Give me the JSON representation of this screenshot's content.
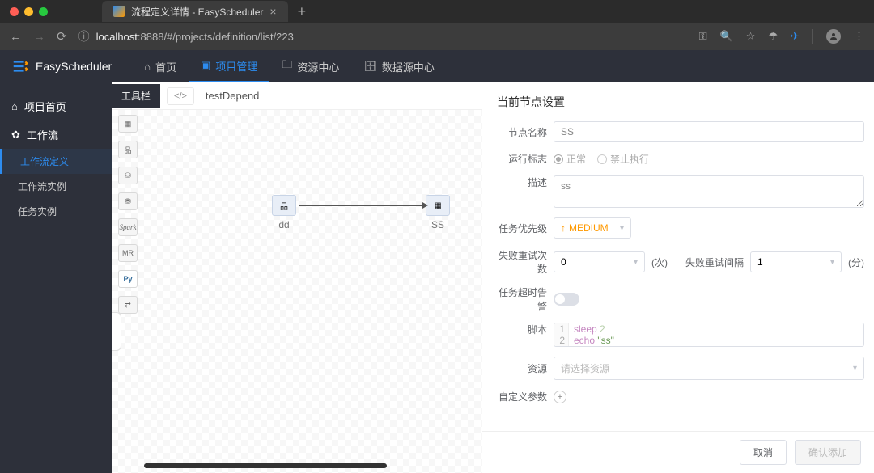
{
  "browser": {
    "tab_title": "流程定义详情 - EasyScheduler",
    "url_prefix": "localhost",
    "url_port": ":8888",
    "url_path": "/#/projects/definition/list/223"
  },
  "header": {
    "product": "EasyScheduler",
    "nav": {
      "home": "首页",
      "projects": "项目管理",
      "resources": "资源中心",
      "datasource": "数据源中心"
    }
  },
  "sidebar": {
    "project_home": "项目首页",
    "workflow": "工作流",
    "workflow_def": "工作流定义",
    "workflow_inst": "工作流实例",
    "task_inst": "任务实例"
  },
  "canvas": {
    "toolbar_label": "工具栏",
    "title": "testDepend",
    "tools": [
      "SHELL",
      "SUB",
      "PROC",
      "SQL",
      "SPARK",
      "MR",
      "PY",
      "DEP"
    ],
    "nodes": {
      "n1": "dd",
      "n2": "SS"
    }
  },
  "panel": {
    "title": "当前节点设置",
    "labels": {
      "node_name": "节点名称",
      "run_flag": "运行标志",
      "desc": "描述",
      "priority": "任务优先级",
      "retry_count": "失败重试次数",
      "retry_interval": "失败重试间隔",
      "timeout": "任务超时告警",
      "script": "脚本",
      "resource": "资源",
      "custom_params": "自定义参数"
    },
    "values": {
      "node_name": "SS",
      "run_flag_normal": "正常",
      "run_flag_forbidden": "禁止执行",
      "desc": "ss",
      "priority": "MEDIUM",
      "retry_count": "0",
      "retry_count_unit": "(次)",
      "retry_interval": "1",
      "retry_interval_unit": "(分)",
      "resource_placeholder": "请选择资源",
      "script_lines": [
        {
          "n": "1",
          "kw": "sleep",
          "arg": "2"
        },
        {
          "n": "2",
          "kw": "echo",
          "str": "\"ss\""
        }
      ]
    },
    "footer": {
      "cancel": "取消",
      "confirm": "确认添加"
    }
  }
}
